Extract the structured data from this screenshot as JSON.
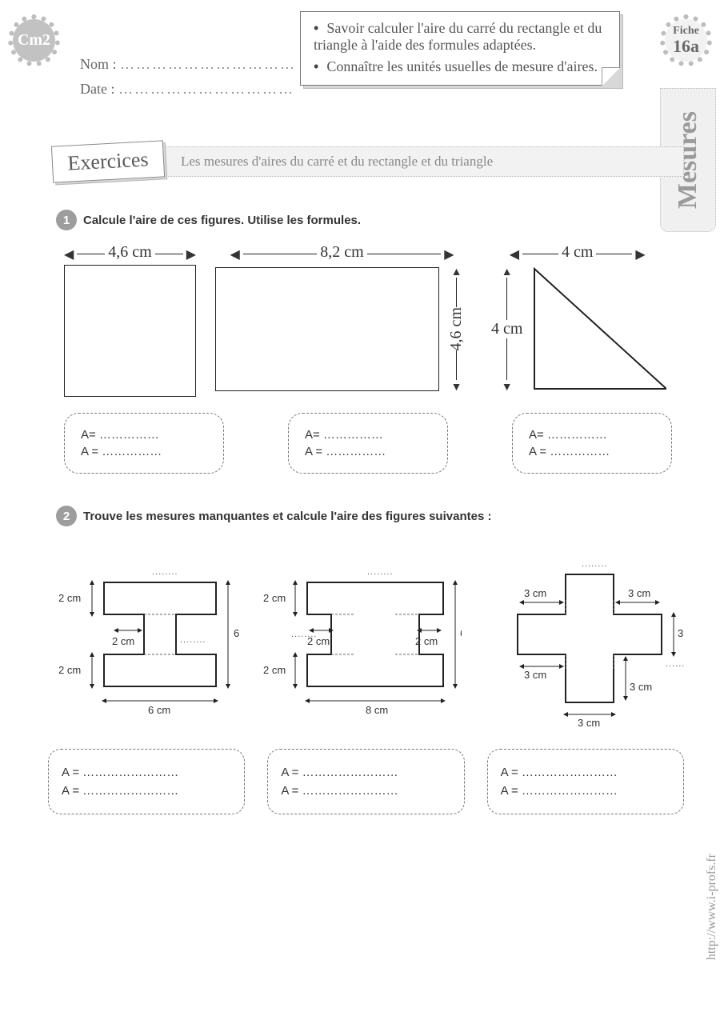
{
  "header": {
    "grade": "Cm2",
    "fiche_label": "Fiche",
    "fiche_number": "16a",
    "name_label": "Nom :",
    "date_label": "Date :",
    "dots": "……………………………",
    "side_category": "Mesures"
  },
  "objectives": {
    "item1": "Savoir calculer l'aire du carré du rectangle et du triangle à l'aide des formules adaptées.",
    "item2": "Connaître les unités usuelles de mesure d'aires."
  },
  "banner": {
    "card": "Exercices",
    "title": "Les mesures d'aires  du carré et du rectangle et du triangle"
  },
  "ex1": {
    "num": "1",
    "prompt": "Calcule l'aire de ces figures. Utilise les formules.",
    "fig1_w": "4,6 cm",
    "fig2_w": "8,2 cm",
    "fig2_h": "4,6 cm",
    "fig3_top": "4 cm",
    "fig3_side": "4 cm",
    "ans_l1": "A= ……………",
    "ans_l2": "A = ……………"
  },
  "ex2": {
    "num": "2",
    "prompt": "Trouve les mesures manquantes et calcule l'aire des figures suivantes :",
    "d2cm": "2 cm",
    "d3cm": "3 cm",
    "d6cm": "6 cm",
    "d8cm": "8 cm",
    "missing": "........",
    "ans_l1": "A = ……………………",
    "ans_l2": "A = ……………………"
  },
  "footer_url": "http://www.i-profs.fr"
}
